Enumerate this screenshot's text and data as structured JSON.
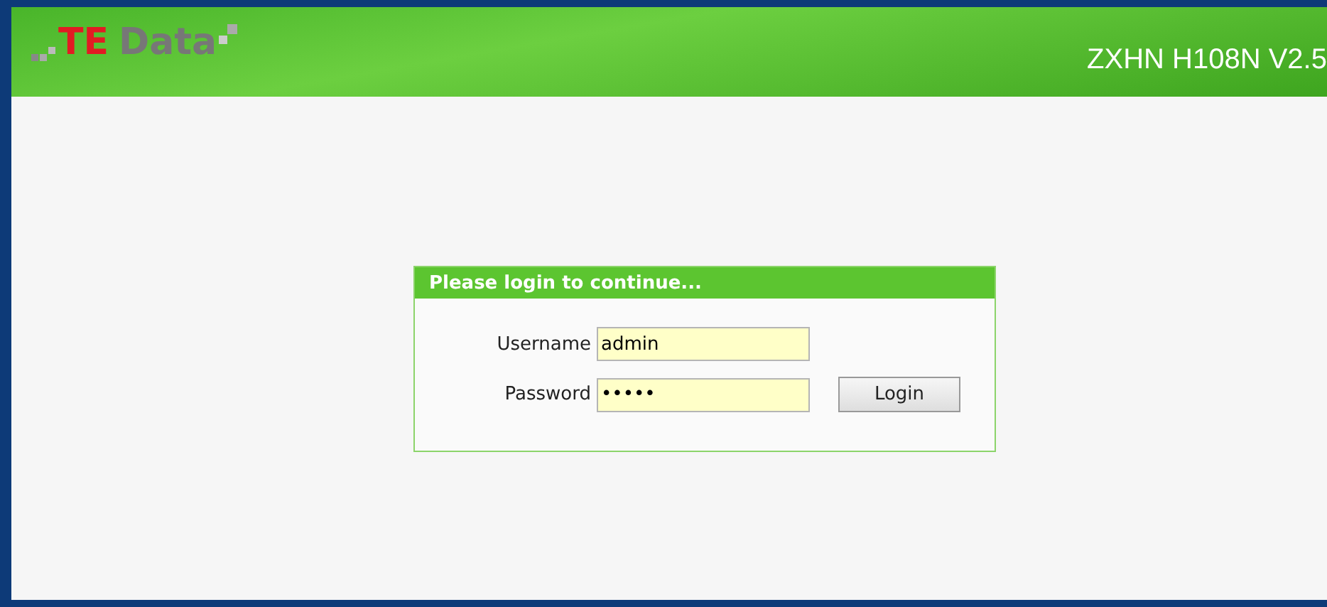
{
  "header": {
    "logo": {
      "te": "TE",
      "data": "Data"
    },
    "model": "ZXHN H108N V2.5"
  },
  "login": {
    "title": "Please login to continue...",
    "fields": [
      {
        "label": "Username",
        "value": "admin"
      },
      {
        "label": "Password",
        "value": "•••••"
      }
    ],
    "button": "Login"
  }
}
